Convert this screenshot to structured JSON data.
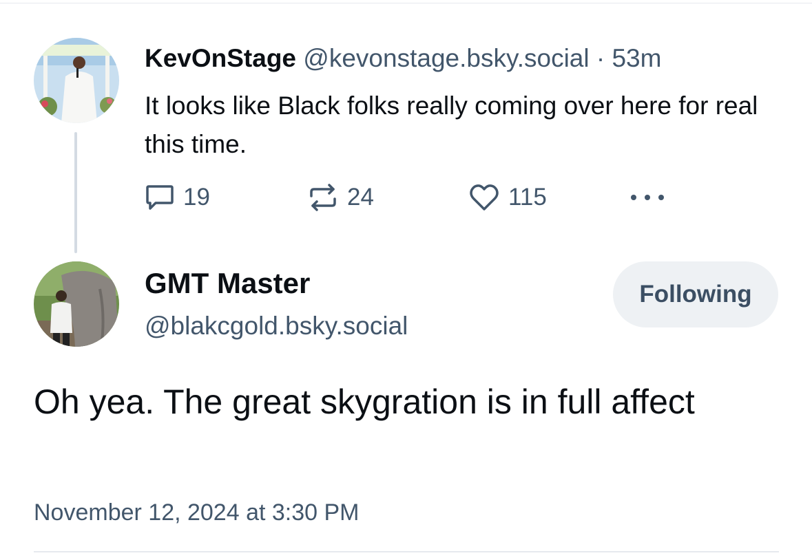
{
  "parent_post": {
    "display_name": "KevOnStage",
    "handle": "@kevonstage.bsky.social",
    "separator": "·",
    "time_ago": "53m",
    "text": "It looks like Black folks really coming over here for real this time.",
    "reply_count": "19",
    "repost_count": "24",
    "like_count": "115",
    "reply_icon": "reply-bubble-icon",
    "repost_icon": "repost-icon",
    "like_icon": "heart-icon",
    "more_icon": "more-horizontal-icon"
  },
  "main_post": {
    "display_name": "GMT Master",
    "handle": "@blakcgold.bsky.social",
    "follow_label": "Following",
    "text": "Oh yea. The great skygration is in full affect",
    "timestamp": "November 12, 2024 at 3:30 PM"
  },
  "colors": {
    "text_primary": "#0b0f14",
    "text_secondary": "#42566b",
    "thread_line": "#d4dbe3",
    "follow_button_bg": "#eef1f4",
    "divider": "#e6e9ee"
  }
}
